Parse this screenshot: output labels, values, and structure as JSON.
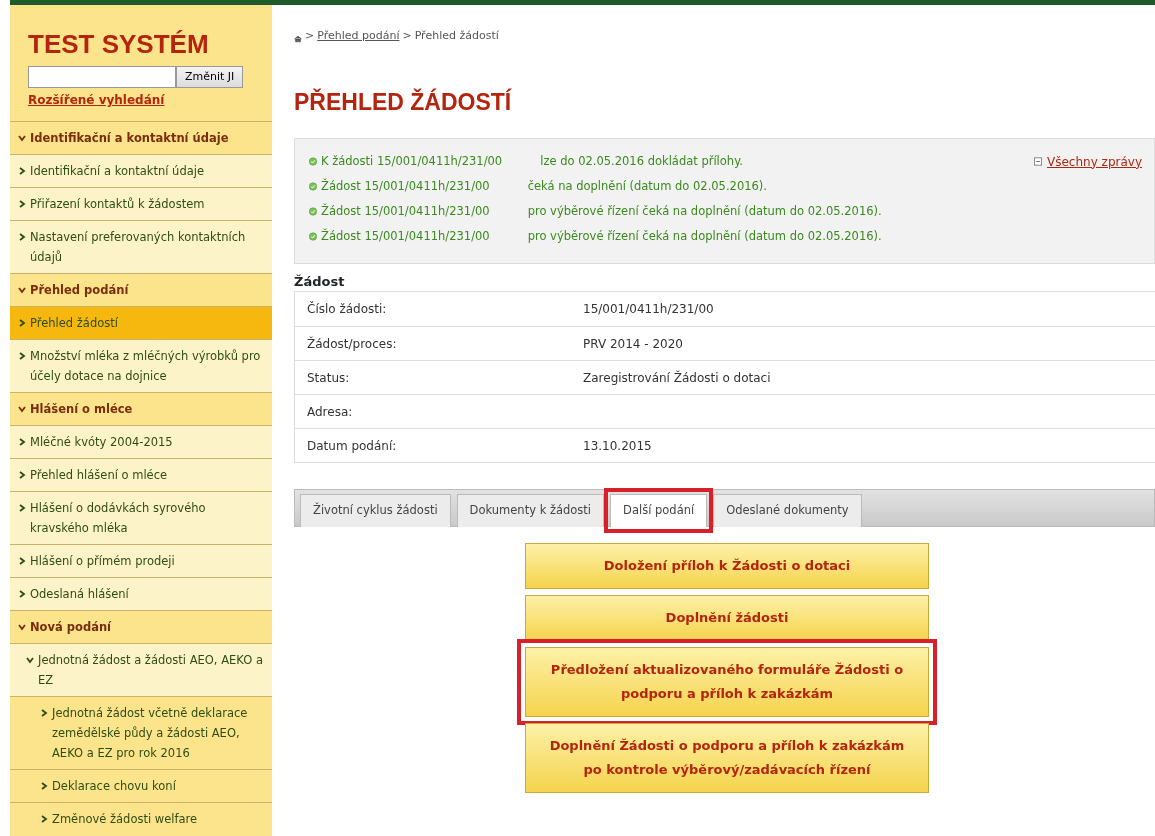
{
  "sidebar": {
    "title": "TEST SYSTÉM",
    "search_button": "Změnit JI",
    "advanced_link": "Rozšířené vyhledání",
    "items": [
      {
        "kind": "section",
        "label": "Identifikační a kontaktní údaje",
        "expanded": true,
        "selected": false
      },
      {
        "kind": "item",
        "label": "Identifikační a kontaktní údaje",
        "selected": false
      },
      {
        "kind": "item",
        "label": "Přiřazení kontaktů k žádostem",
        "selected": false
      },
      {
        "kind": "item",
        "label": "Nastavení preferovaných kontaktních údajů",
        "selected": false
      },
      {
        "kind": "section",
        "label": "Přehled podání",
        "expanded": true,
        "selected": false
      },
      {
        "kind": "item",
        "label": "Přehled žádostí",
        "selected": true
      },
      {
        "kind": "item",
        "label": "Množství mléka z mléčných výrobků pro účely dotace na dojnice",
        "selected": false
      },
      {
        "kind": "section",
        "label": "Hlášení o mléce",
        "expanded": true,
        "selected": false
      },
      {
        "kind": "item",
        "label": "Mléčné kvóty 2004-2015",
        "selected": false
      },
      {
        "kind": "item",
        "label": "Přehled hlášení o mléce",
        "selected": false
      },
      {
        "kind": "item",
        "label": "Hlášení o dodávkách syrového kravského mléka",
        "selected": false
      },
      {
        "kind": "item",
        "label": "Hlášení o přímém prodeji",
        "selected": false
      },
      {
        "kind": "item",
        "label": "Odeslaná hlášení",
        "selected": false
      },
      {
        "kind": "section",
        "label": "Nová podání",
        "expanded": true,
        "selected": false
      },
      {
        "kind": "group",
        "label": "Jednotná žádost a žádosti AEO, AEKO a EZ",
        "expanded": true,
        "selected": false,
        "children": [
          {
            "kind": "subitem",
            "label": "Jednotná žádost včetně deklarace zemědělské půdy a žádosti AEO, AEKO a EZ pro rok 2016",
            "selected": false
          },
          {
            "kind": "subitem",
            "label": "Deklarace chovu koní",
            "selected": false
          },
          {
            "kind": "subitem",
            "label": "Změnové žádosti welfare",
            "selected": false
          }
        ]
      }
    ]
  },
  "breadcrumb": [
    {
      "separator": ">",
      "label": "Přehled podání",
      "link": true
    },
    {
      "separator": ">",
      "label": "Přehled žádostí",
      "link": false
    }
  ],
  "page_title": "PŘEHLED ŽÁDOSTÍ",
  "messages": [
    {
      "id": "K žádosti 15/001/0411h/231/00",
      "text": "lze do 02.05.2016 dokládat přílohy."
    },
    {
      "id": "Žádost 15/001/0411h/231/00",
      "text": "čeká na doplnění (datum do 02.05.2016)."
    },
    {
      "id": "Žádost 15/001/0411h/231/00",
      "text": "pro výběrové řízení čeká na doplnění (datum do 02.05.2016)."
    },
    {
      "id": "Žádost 15/001/0411h/231/00",
      "text": "pro výběrové řízení čeká na doplnění (datum do 02.05.2016)."
    }
  ],
  "all_messages_link": "Všechny zprávy",
  "detail": {
    "title": "Žádost",
    "rows": [
      {
        "label": "Číslo žádosti:",
        "value": "15/001/0411h/231/00"
      },
      {
        "label": "Žádost/proces:",
        "value": "PRV 2014 - 2020"
      },
      {
        "label": "Status:",
        "value": "Zaregistrování Žádosti o dotaci"
      },
      {
        "label": "Adresa:"
      },
      {
        "label": "Datum podání:",
        "value": "13.10.2015"
      }
    ]
  },
  "tabs": [
    {
      "label": "Životní cyklus žádosti",
      "selected": false,
      "highlighted": false
    },
    {
      "label": "Dokumenty k žádosti",
      "selected": false,
      "highlighted": false
    },
    {
      "label": "Další podání",
      "selected": true,
      "highlighted": true
    },
    {
      "label": "Odeslané dokumenty",
      "selected": false,
      "highlighted": false
    }
  ],
  "actions": [
    {
      "label": "Doložení příloh k Žádosti o dotaci",
      "highlighted": false
    },
    {
      "label": "Doplnění žádosti",
      "highlighted": false
    },
    {
      "label": "Předložení aktualizovaného formuláře Žádosti o podporu a příloh k zakázkám",
      "highlighted": true
    },
    {
      "label": "Doplnění Žádosti o podporu a příloh k zakázkám po kontrole výběrový/zadávacích řízení",
      "highlighted": false
    }
  ]
}
